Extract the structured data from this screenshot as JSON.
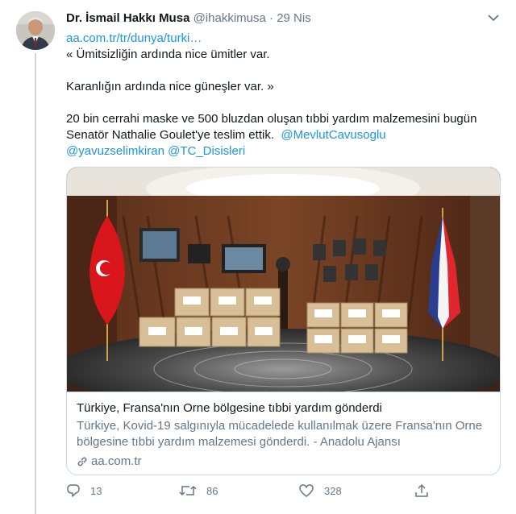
{
  "tweet": {
    "author_name": "Dr. İsmail Hakkı Musa",
    "author_handle": "@ihakkimusa",
    "separator": "·",
    "date": "29 Nis",
    "link": "aa.com.tr/tr/dunya/turki…",
    "line1": "« Ümitsizliğin ardında nice ümitler var.",
    "line2": "Karanlığın ardında nice güneşler var. »",
    "line3": "20 bin cerrahi maske ve 500 bluzdan oluşan tıbbi yardım malzemesini bugün",
    "line4_text": "Senatör Nathalie Goulet'ye teslim ettik.",
    "mention1": "@MevlutCavusoglu",
    "mention2": "@yavuzselimkiran",
    "mention3": "@TC_Disisleri"
  },
  "card": {
    "title": "Türkiye, Fransa'nın Orne bölgesine tıbbi yardım gönderdi",
    "description": "Türkiye, Kovid-19 salgınıyla mücadelede kullanılmak üzere Fransa'nın Orne bölgesine tıbbi yardım malzemesi gönderdi. - Anadolu Ajansı",
    "domain": "aa.com.tr"
  },
  "actions": {
    "replies": "13",
    "retweets": "86",
    "likes": "328"
  },
  "icons": [
    "chevron-down-icon",
    "reply-icon",
    "retweet-icon",
    "like-icon",
    "share-icon",
    "link-icon"
  ],
  "colors": {
    "link": "#1b95e0",
    "muted": "#657786",
    "text": "#14171a",
    "border": "#ccd6dd"
  }
}
